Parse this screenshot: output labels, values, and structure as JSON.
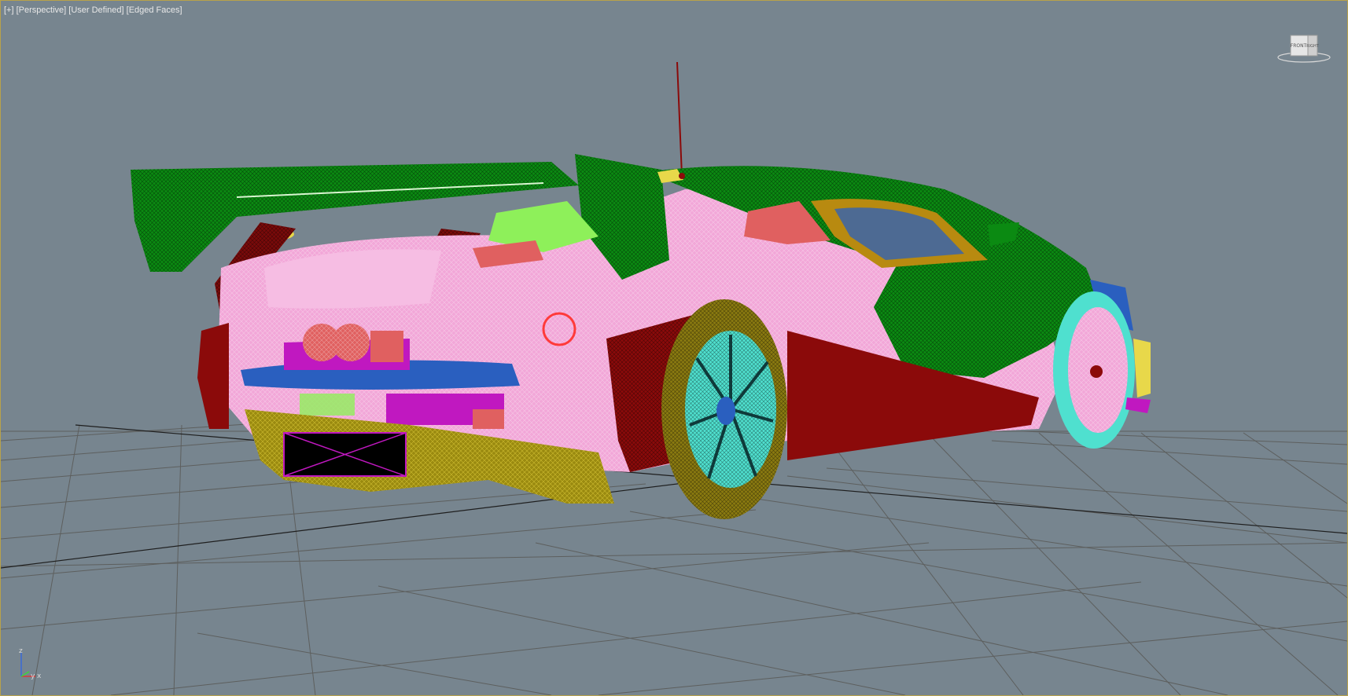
{
  "viewport": {
    "labels": [
      "[+]",
      "[Perspective]",
      "[User Defined]",
      "[Edged Faces]"
    ]
  },
  "viewcube": {
    "face_front": "FRONT",
    "face_side": "RIGHT",
    "icon": "viewcube-icon"
  },
  "axis_tripod": {
    "z": "z",
    "x": "x",
    "y": "y"
  },
  "colors": {
    "background": "#77858f",
    "grid": "#5a5a5a",
    "border": "#b8a24a",
    "body_pink": "#f2a7d8",
    "wing_green": "#0b8a12",
    "accent_red": "#8b0a0a",
    "wheel_cyan": "#4fe0cf",
    "tyre_olive": "#8a7a10",
    "diffuser_olive": "#9a8a10",
    "under_blue": "#2a5fbf",
    "light_green": "#8ef05a",
    "coral": "#e06060",
    "magenta": "#c018c0"
  }
}
